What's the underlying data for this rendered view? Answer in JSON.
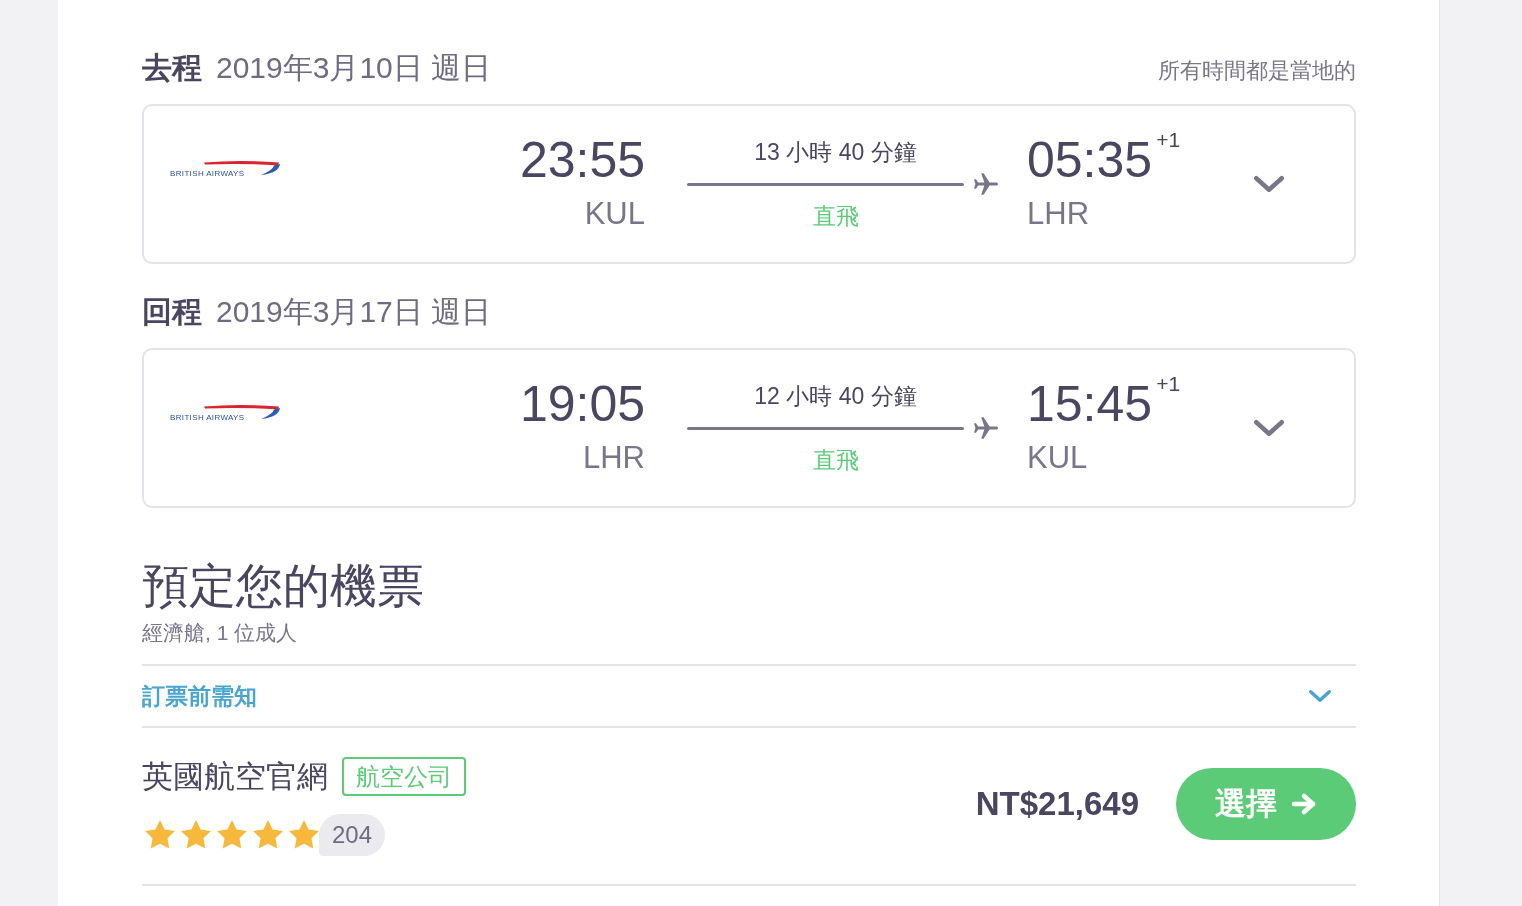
{
  "legs": [
    {
      "label": "去程",
      "date": "2019年3月10日 週日",
      "note": "所有時間都是當地的",
      "flight": {
        "airline_logo_text": "BRITISH AIRWAYS",
        "departure_time": "23:55",
        "departure_airport": "KUL",
        "duration": "13 小時 40 分鐘",
        "stops": "直飛",
        "arrival_time": "05:35",
        "arrival_day_offset": "+1",
        "arrival_airport": "LHR",
        "expanded": false
      }
    },
    {
      "label": "回程",
      "date": "2019年3月17日 週日",
      "flight": {
        "airline_logo_text": "BRITISH AIRWAYS",
        "departure_time": "19:05",
        "departure_airport": "LHR",
        "duration": "12 小時 40 分鐘",
        "stops": "直飛",
        "arrival_time": "15:45",
        "arrival_day_offset": "+1",
        "arrival_airport": "KUL",
        "expanded": false
      }
    }
  ],
  "booking": {
    "title": "預定您的機票",
    "subtitle": "經濟艙, 1 位成人",
    "notice": {
      "label": "訂票前需知",
      "expanded": false
    },
    "offers": [
      {
        "provider": "英國航空官網",
        "tag": "航空公司",
        "stars": 5,
        "review_count": "204",
        "price": "NT$21,649",
        "button": "選擇"
      }
    ]
  }
}
